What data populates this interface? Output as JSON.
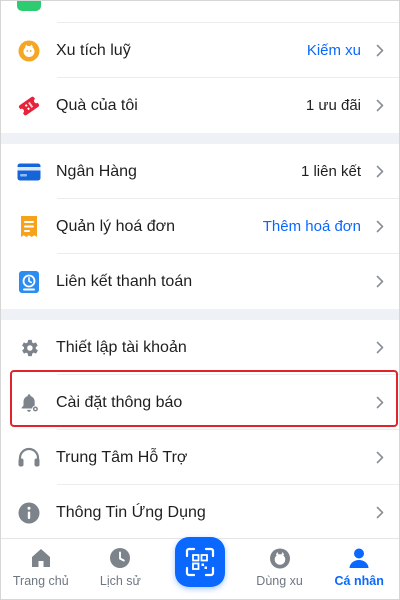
{
  "menu": {
    "rows": [
      {
        "label": "Xu tích luỹ",
        "value": "Kiếm xu",
        "icon": "coin-icon"
      },
      {
        "label": "Quà của tôi",
        "value": "1 ưu đãi",
        "icon": "gift-ticket-icon"
      },
      {
        "label": "Ngân Hàng",
        "value": "1 liên kết",
        "icon": "bank-card-icon"
      },
      {
        "label": "Quản lý hoá đơn",
        "value": "Thêm hoá đơn",
        "icon": "bill-icon"
      },
      {
        "label": "Liên kết thanh toán",
        "value": "",
        "icon": "payment-link-icon"
      },
      {
        "label": "Thiết lập tài khoản",
        "value": "",
        "icon": "gear-icon"
      },
      {
        "label": "Cài đặt thông báo",
        "value": "",
        "icon": "bell-settings-icon"
      },
      {
        "label": "Trung Tâm Hỗ Trợ",
        "value": "",
        "icon": "headset-icon"
      },
      {
        "label": "Thông Tin Ứng Dụng",
        "value": "",
        "icon": "info-icon"
      }
    ]
  },
  "nav": {
    "home": "Trang chủ",
    "history": "Lịch sử",
    "coins": "Dùng xu",
    "profile": "Cá nhân"
  },
  "colors": {
    "accent": "#0a68ff",
    "highlight": "#e0242c",
    "section_gap": "#eef1f6"
  }
}
